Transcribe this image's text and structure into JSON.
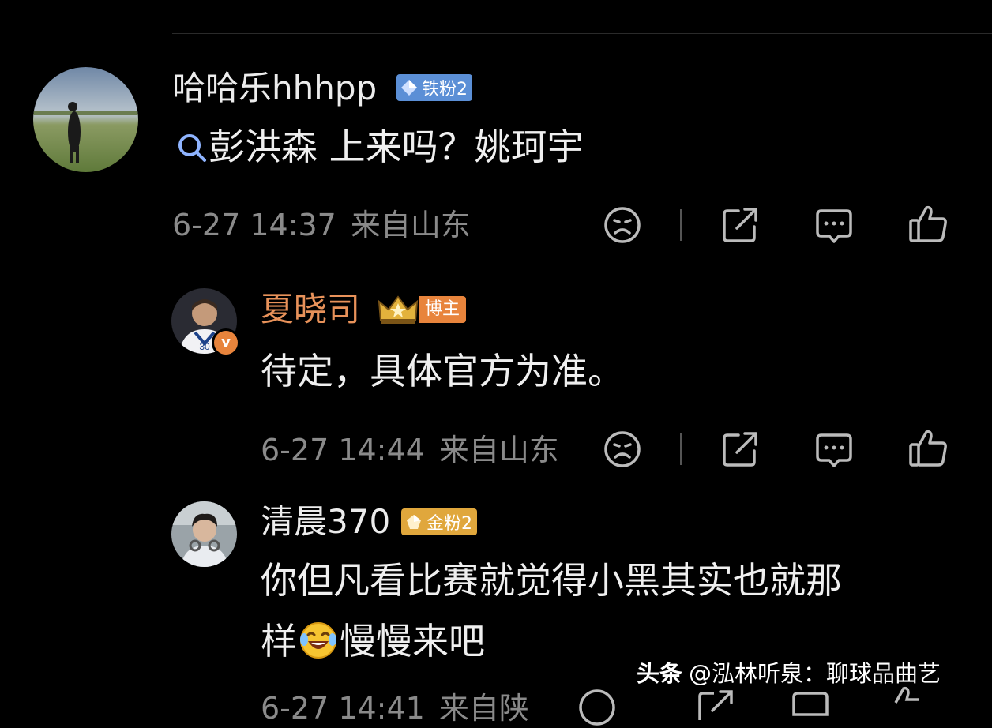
{
  "comments": [
    {
      "username": "哈哈乐hhhpp",
      "badge": "铁粉2",
      "search_query": "彭洪森",
      "text_rest": " 上来吗？姚珂宇",
      "date": "6-27 14:37",
      "location": "来自山东"
    },
    {
      "username": "夏晓司",
      "badge": "博主",
      "text": "待定，具体官方为准。",
      "date": "6-27 14:44",
      "location": "来自山东",
      "verified_mark": "v"
    },
    {
      "username": "清晨370",
      "badge": "金粉2",
      "text_line1": "你但凡看比赛就觉得小黑其实也就那",
      "text_line2_a": "样",
      "text_line2_b": "慢慢来吧",
      "date": "6-27 14:41",
      "location": "来自陕"
    }
  ],
  "watermark": {
    "brand": "头条",
    "handle": "@泓林听泉：聊球品曲艺"
  },
  "colors": {
    "background": "#000000",
    "username": "#ececec",
    "blogger_name": "#e8925a",
    "meta": "#8a8a8a",
    "iron_badge": "#5b8fd6",
    "blogger_badge": "#e8843c",
    "gold_badge": "#e0a73c"
  },
  "icons": [
    "search-icon",
    "dislike-face-icon",
    "share-icon",
    "reply-icon",
    "like-icon",
    "laugh-cry-emoji"
  ]
}
